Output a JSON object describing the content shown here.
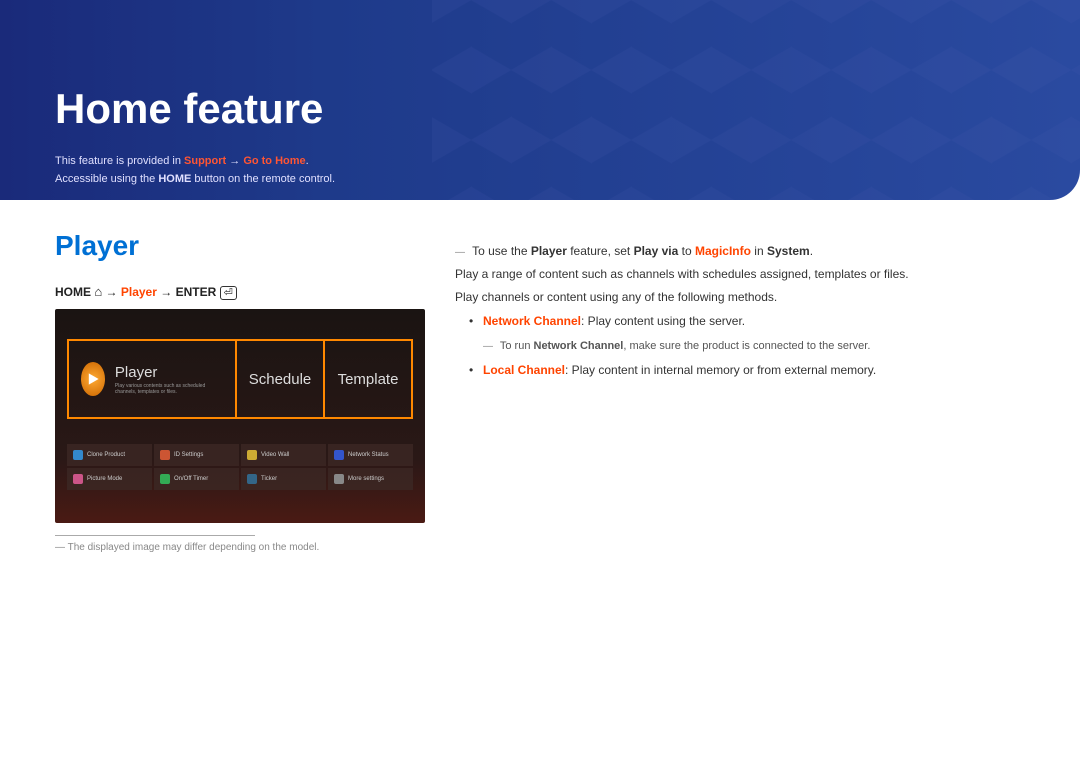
{
  "banner": {
    "title": "Home feature",
    "line1_pre": "This feature is provided in ",
    "line1_link1": "Support",
    "line1_arrow": " → ",
    "line1_link2": "Go to Home",
    "line1_post": ".",
    "line2_pre": "Accessible using the ",
    "line2_strong": "HOME",
    "line2_post": " button on the remote control."
  },
  "section": {
    "title": "Player",
    "nav": {
      "home": "HOME",
      "player": "Player",
      "enter": "ENTER"
    }
  },
  "device_ui": {
    "tiles": {
      "player": "Player",
      "player_desc": "Play various contents such as scheduled channels, templates or files.",
      "schedule": "Schedule",
      "template": "Template"
    },
    "grid": [
      {
        "label": "Clone Product",
        "color": "#3388cc"
      },
      {
        "label": "ID Settings",
        "color": "#cc5533"
      },
      {
        "label": "Video Wall",
        "color": "#ccaa33"
      },
      {
        "label": "Network Status",
        "color": "#3355cc"
      },
      {
        "label": "Picture Mode",
        "color": "#cc5588"
      },
      {
        "label": "On/Off Timer",
        "color": "#33aa55"
      },
      {
        "label": "Ticker",
        "color": "#336688"
      },
      {
        "label": "More settings",
        "color": "#888888"
      }
    ]
  },
  "footnote": "The displayed image may differ depending on the model.",
  "body": {
    "note1_pre": "To use the ",
    "note1_s1": "Player",
    "note1_mid1": " feature, set ",
    "note1_s2": "Play via",
    "note1_mid2": " to ",
    "note1_s3": "MagicInfo",
    "note1_mid3": " in ",
    "note1_s4": "System",
    "note1_post": ".",
    "para1": "Play a range of content such as channels with schedules assigned, templates or files.",
    "para2": "Play channels or content using any of the following methods.",
    "bullet1_s": "Network Channel",
    "bullet1_t": ": Play content using the server.",
    "subnote_pre": "To run ",
    "subnote_s": "Network Channel",
    "subnote_post": ", make sure the product is connected to the server.",
    "bullet2_s": "Local Channel",
    "bullet2_t": ": Play content in internal memory or from external memory."
  }
}
